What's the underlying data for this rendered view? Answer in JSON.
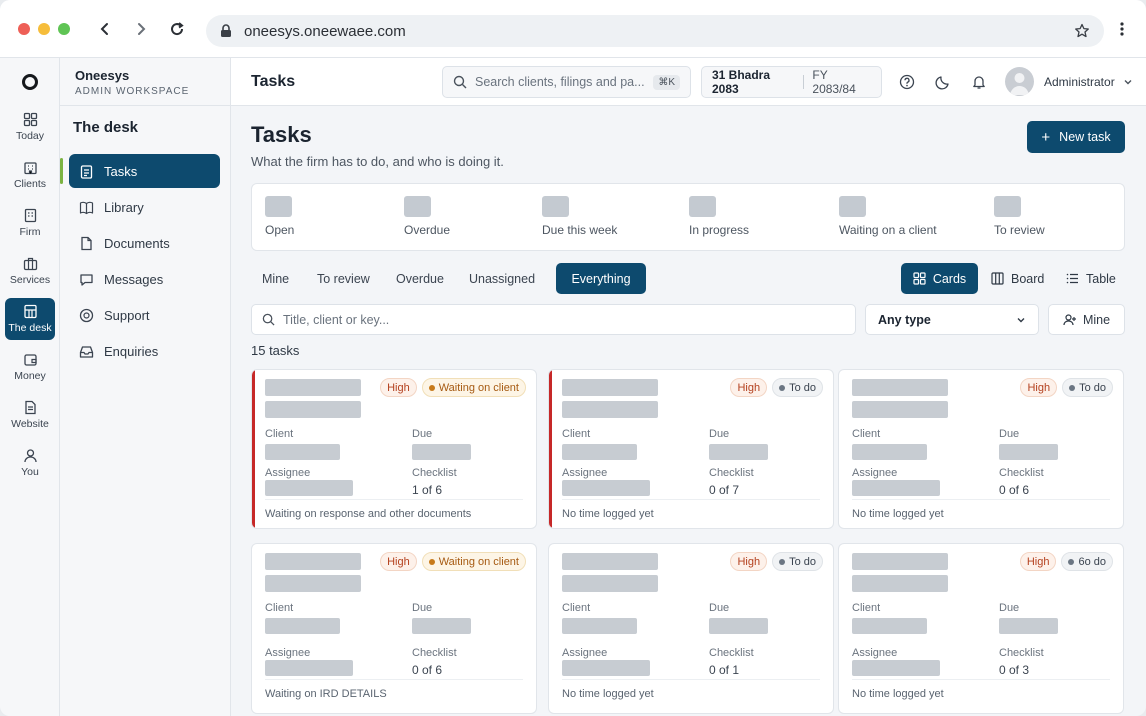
{
  "browser": {
    "url": "oneesys.oneewaee.com",
    "traffic_lights": [
      "#ee5f57",
      "#f6bd3b",
      "#5fc454"
    ]
  },
  "rail": {
    "items": [
      {
        "label": "Today",
        "icon": "grid-icon"
      },
      {
        "label": "Clients",
        "icon": "building-icon"
      },
      {
        "label": "Firm",
        "icon": "office-icon"
      },
      {
        "label": "Services",
        "icon": "briefcase-icon"
      },
      {
        "label": "The desk",
        "icon": "desk-icon",
        "active": true
      },
      {
        "label": "Money",
        "icon": "wallet-icon"
      },
      {
        "label": "Website",
        "icon": "page-icon"
      },
      {
        "label": "You",
        "icon": "user-icon"
      }
    ]
  },
  "sidebar": {
    "workspace_name": "Oneesys",
    "workspace_sub": "ADMIN WORKSPACE",
    "section_title": "The desk",
    "items": [
      {
        "label": "Tasks",
        "icon": "clipboard-icon",
        "active": true
      },
      {
        "label": "Library",
        "icon": "book-icon"
      },
      {
        "label": "Documents",
        "icon": "document-icon"
      },
      {
        "label": "Messages",
        "icon": "chat-icon"
      },
      {
        "label": "Support",
        "icon": "lifebuoy-icon"
      },
      {
        "label": "Enquiries",
        "icon": "inbox-icon"
      }
    ]
  },
  "topbar": {
    "title": "Tasks",
    "search_placeholder": "Search clients, filings and pa...",
    "search_shortcut": "⌘K",
    "date": "31 Bhadra 2083",
    "fiscal_year": "FY 2083/84",
    "user_name": "Administrator"
  },
  "page": {
    "title": "Tasks",
    "subtitle": "What the firm has to do, and who is doing it.",
    "new_task_label": "New task",
    "stats": [
      "Open",
      "Overdue",
      "Due this week",
      "In progress",
      "Waiting on a client",
      "To review"
    ],
    "filter_tabs": [
      "Mine",
      "To review",
      "Overdue",
      "Unassigned",
      "Everything"
    ],
    "active_filter": "Everything",
    "views": [
      "Cards",
      "Board",
      "Table"
    ],
    "active_view": "Cards",
    "filter_placeholder": "Title, client or key...",
    "type_select": "Any type",
    "mine_button": "Mine",
    "task_count": "15 tasks"
  },
  "labels": {
    "client": "Client",
    "due": "Due",
    "assignee": "Assignee",
    "checklist": "Checklist"
  },
  "tasks": [
    {
      "priority": "High",
      "status": "Waiting on client",
      "checklist": "1 of 6",
      "footer": "Waiting on response and other documents",
      "overdue": true
    },
    {
      "priority": "High",
      "status": "To do",
      "checklist": "0 of 7",
      "footer": "No time logged yet",
      "overdue": true
    },
    {
      "priority": "High",
      "status": "To do",
      "checklist": "0 of 6",
      "footer": "No time logged yet",
      "overdue": false
    },
    {
      "priority": "High",
      "status": "Waiting on client",
      "checklist": "0 of 6",
      "footer": "Waiting on IRD DETAILS",
      "overdue": false
    },
    {
      "priority": "High",
      "status": "To do",
      "checklist": "0 of 1",
      "footer": "No time logged yet",
      "overdue": false
    },
    {
      "priority": "High",
      "status": "6o do",
      "checklist": "0 of 3",
      "footer": "No time logged yet",
      "overdue": false
    }
  ],
  "colors": {
    "primary": "#0d4a6e",
    "overdue_bar": "#c62828",
    "priority_text": "#b4411f",
    "waiting_dot": "#c77a1a",
    "todo_dot": "#6b7683"
  }
}
